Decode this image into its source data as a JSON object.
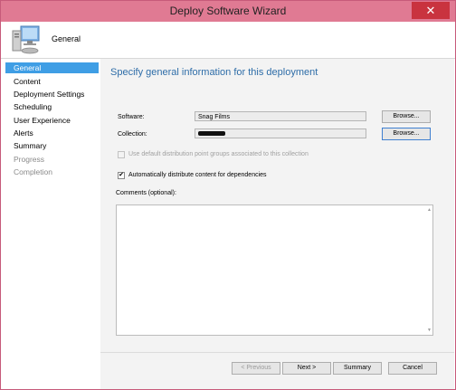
{
  "window": {
    "title": "Deploy Software Wizard",
    "close_glyph": "✕"
  },
  "header": {
    "icon": "computer-icon",
    "title": "General"
  },
  "sidebar": {
    "items": [
      {
        "label": "General",
        "state": "active"
      },
      {
        "label": "Content",
        "state": "normal"
      },
      {
        "label": "Deployment Settings",
        "state": "normal"
      },
      {
        "label": "Scheduling",
        "state": "normal"
      },
      {
        "label": "User Experience",
        "state": "normal"
      },
      {
        "label": "Alerts",
        "state": "normal"
      },
      {
        "label": "Summary",
        "state": "normal"
      },
      {
        "label": "Progress",
        "state": "disabled"
      },
      {
        "label": "Completion",
        "state": "disabled"
      }
    ]
  },
  "main": {
    "heading": "Specify general information for this deployment",
    "software": {
      "label": "Software:",
      "value": "Snag Films",
      "browse_label": "Browse..."
    },
    "collection": {
      "label": "Collection:",
      "value": "",
      "browse_label": "Browse..."
    },
    "dp_groups_checkbox": {
      "label": "Use default distribution point groups associated to this collection",
      "checked": false,
      "enabled": false
    },
    "auto_distribute_checkbox": {
      "label": "Automatically distribute content for dependencies",
      "checked": true,
      "enabled": true
    },
    "comments": {
      "label": "Comments (optional):",
      "value": ""
    }
  },
  "footer": {
    "previous_label": "< Previous",
    "next_label": "Next >",
    "summary_label": "Summary",
    "cancel_label": "Cancel"
  },
  "colors": {
    "titlebar": "#e07a93",
    "active_nav": "#3f9ee5",
    "heading": "#2e6da8",
    "close": "#c9333f"
  }
}
